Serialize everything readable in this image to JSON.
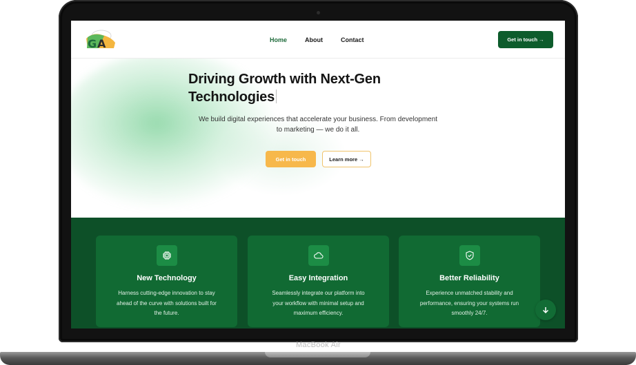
{
  "device": {
    "label": "MacBook Air"
  },
  "nav": {
    "links": [
      {
        "label": "Home",
        "active": true
      },
      {
        "label": "About",
        "active": false
      },
      {
        "label": "Contact",
        "active": false
      }
    ],
    "cta_label": "Get in touch →"
  },
  "hero": {
    "title_line1": "Driving Growth with Next-Gen",
    "title_line2": "Technologies",
    "subtitle_line1": "We build digital experiences that accelerate your business. From development",
    "subtitle_line2": "to marketing — we do it all.",
    "primary_button": "Get in touch",
    "secondary_button": "Learn more →"
  },
  "features": [
    {
      "icon": "cpu-chip-icon",
      "title": "New Technology",
      "lines": [
        "Harness cutting-edge innovation to stay",
        "ahead of the curve with solutions built for",
        "the future."
      ]
    },
    {
      "icon": "cloud-icon",
      "title": "Easy Integration",
      "lines": [
        "Seamlessly integrate our platform into",
        "your workflow with minimal setup and",
        "maximum efficiency."
      ]
    },
    {
      "icon": "shield-check-icon",
      "title": "Better Reliability",
      "lines": [
        "Experience unmatched stability and",
        "performance, ensuring your systems run",
        "smoothly 24/7."
      ]
    }
  ],
  "colors": {
    "brand_green": "#0d5c2c",
    "section_green": "#0d5028",
    "card_green": "#116a33",
    "accent_orange": "#f7b84b"
  },
  "scroll_button": {
    "icon": "arrow-down-icon"
  }
}
